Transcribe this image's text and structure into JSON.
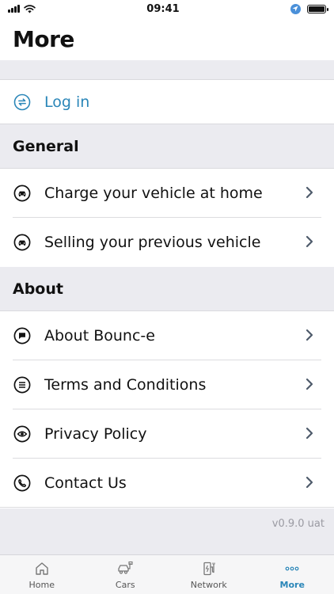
{
  "status_bar": {
    "time": "09:41"
  },
  "header": {
    "title": "More"
  },
  "login": {
    "label": "Log in"
  },
  "sections": {
    "general": {
      "title": "General",
      "items": [
        {
          "label": "Charge your vehicle at home",
          "icon": "car-icon"
        },
        {
          "label": "Selling your previous vehicle",
          "icon": "car-icon"
        }
      ]
    },
    "about": {
      "title": "About",
      "items": [
        {
          "label": "About Bounc-e",
          "icon": "chat-bubble-icon"
        },
        {
          "label": "Terms and Conditions",
          "icon": "list-icon"
        },
        {
          "label": "Privacy Policy",
          "icon": "eye-icon"
        },
        {
          "label": "Contact Us",
          "icon": "phone-icon"
        }
      ]
    }
  },
  "footer": {
    "version": "v0.9.0 uat"
  },
  "tabbar": {
    "active": "More",
    "tabs": [
      {
        "label": "Home",
        "icon": "home-icon"
      },
      {
        "label": "Cars",
        "icon": "cars-icon"
      },
      {
        "label": "Network",
        "icon": "charger-icon"
      },
      {
        "label": "More",
        "icon": "more-dots-icon"
      }
    ]
  },
  "colors": {
    "accent": "#2a86b8",
    "band": "#ebebf0",
    "text": "#111111",
    "chevron": "#4e5b6b"
  }
}
